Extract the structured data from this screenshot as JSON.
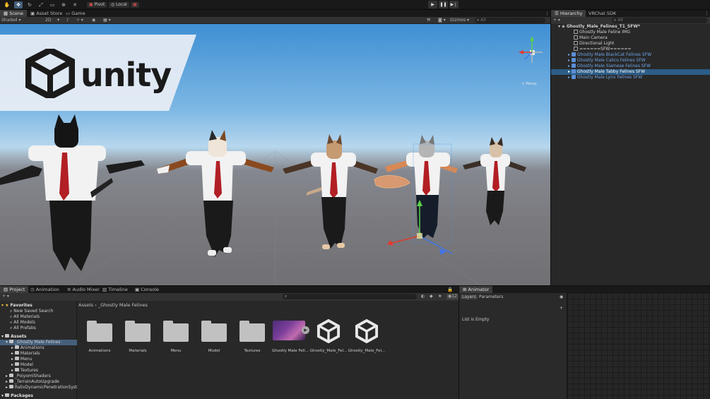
{
  "toolbar": {
    "pivot_label": "Pivot",
    "local_label": "Local"
  },
  "scene_tabs": [
    {
      "label": "Scene"
    },
    {
      "label": "Asset Store"
    },
    {
      "label": "Game"
    }
  ],
  "scene_options": {
    "shading": "Shaded",
    "mode_2d": "2D",
    "gizmos": "Gizmos",
    "search_placeholder": "All",
    "persp_label": "≺ Persp"
  },
  "logo": {
    "word": "unity"
  },
  "hierarchy": {
    "tabs": [
      {
        "label": "Hierarchy"
      },
      {
        "label": "VRChat SDK"
      }
    ],
    "search_placeholder": "All",
    "scene_name": "Ghostly_Male_Felines_T1_SFW*",
    "items": [
      {
        "label": "Ghostly Male Feline IMG",
        "type": "go"
      },
      {
        "label": "Main Camera",
        "type": "go"
      },
      {
        "label": "Directional Light",
        "type": "go"
      },
      {
        "label": "======SFW======",
        "type": "go"
      },
      {
        "label": "Ghostly Male BlackCat Felines SFW",
        "type": "prefab"
      },
      {
        "label": "Ghostly Male Calico Felines SFW",
        "type": "prefab"
      },
      {
        "label": "Ghostly Male Siamese Felines SFW",
        "type": "prefab"
      },
      {
        "label": "Ghostly Male Tabby Felines SFW",
        "type": "prefab",
        "selected": true
      },
      {
        "label": "Ghostly Male Lynx Felines SFW",
        "type": "prefab"
      }
    ]
  },
  "project": {
    "tabs": [
      {
        "label": "Project"
      },
      {
        "label": "Animation"
      },
      {
        "label": "Audio Mixer"
      },
      {
        "label": "Timeline"
      },
      {
        "label": "Console"
      }
    ],
    "breadcrumb": "Assets  ›  _Ghostly Male Felines",
    "slider_value": "12",
    "tree": [
      {
        "label": "Favorites",
        "kind": "fav-root"
      },
      {
        "label": "New Saved Search",
        "kind": "search"
      },
      {
        "label": "All Materials",
        "kind": "search"
      },
      {
        "label": "All Models",
        "kind": "search"
      },
      {
        "label": "All Prefabs",
        "kind": "search"
      },
      {
        "label": "Assets",
        "kind": "root"
      },
      {
        "label": "_Ghostly Male Felines",
        "kind": "folder1",
        "selected": true
      },
      {
        "label": "Animations",
        "kind": "folder2"
      },
      {
        "label": "Materials",
        "kind": "folder2"
      },
      {
        "label": "Menu",
        "kind": "folder2"
      },
      {
        "label": "Model",
        "kind": "folder2"
      },
      {
        "label": "Textures",
        "kind": "folder2"
      },
      {
        "label": "_PoiyomiShaders",
        "kind": "folder1"
      },
      {
        "label": "_TerrainAutoUpgrade",
        "kind": "folder1"
      },
      {
        "label": "RalivDynamicPenetrationSyst",
        "kind": "folder1"
      },
      {
        "label": "Packages",
        "kind": "root"
      }
    ],
    "assets": [
      {
        "label": "Animations",
        "type": "folder"
      },
      {
        "label": "Materials",
        "type": "folder"
      },
      {
        "label": "Menu",
        "type": "folder"
      },
      {
        "label": "Model",
        "type": "folder"
      },
      {
        "label": "Textures",
        "type": "folder"
      },
      {
        "label": "Ghostly Male Feli...",
        "type": "image"
      },
      {
        "label": "Ghostly_Male_Fel...",
        "type": "unity"
      },
      {
        "label": "Ghostly_Male_Fel...",
        "type": "unity"
      }
    ]
  },
  "animator": {
    "tab": "Animator",
    "subtabs": [
      {
        "label": "Layers"
      },
      {
        "label": "Parameters"
      }
    ],
    "empty_text": "List is Empty"
  },
  "colors": {
    "selection": "#2c5d87",
    "prefab_text": "#6fa4e6",
    "panel_bg": "#282828"
  }
}
